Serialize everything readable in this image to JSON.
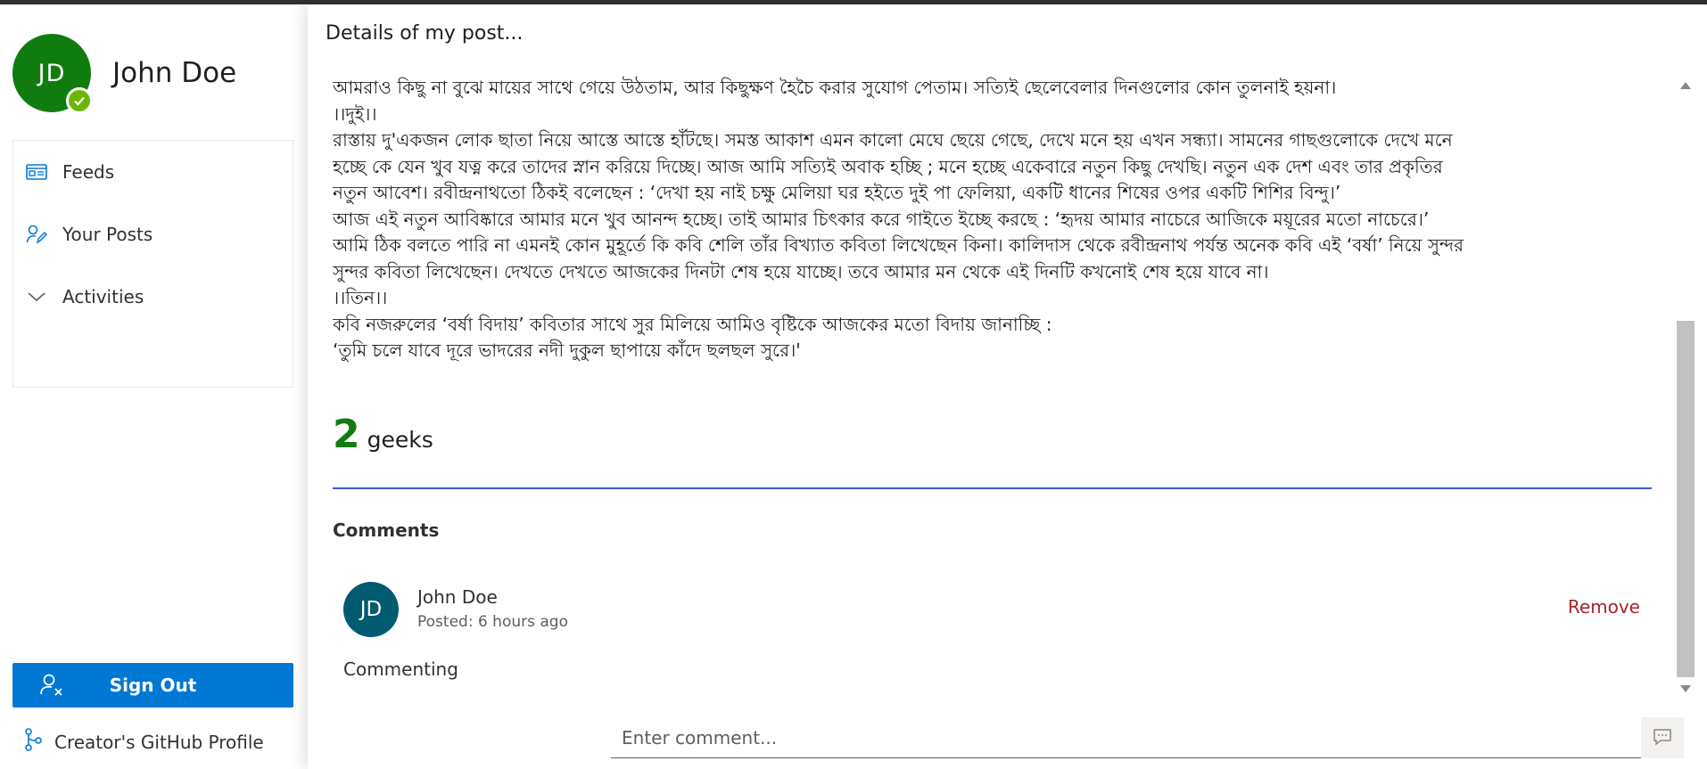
{
  "user": {
    "initials": "JD",
    "name": "John Doe"
  },
  "nav": [
    {
      "label": "Feeds",
      "icon": "feeds-icon"
    },
    {
      "label": "Your Posts",
      "icon": "posts-icon"
    },
    {
      "label": "Activities",
      "icon": "chevron-down-icon"
    }
  ],
  "sign_out_label": "Sign Out",
  "github_label": "Creator's GitHub Profile",
  "panel_title": "Details of my post...",
  "post_lines": [
    "আমরাও কিছু না বুঝে মায়ের সাথে গেয়ে উঠতাম, আর কিছুক্ষণ হৈচৈ করার সুযোগ পেতাম। সত্যিই ছেলেবেলার দিনগুলোর কোন তুলনাই হয়না।",
    "।।দুই।।",
    "রাস্তায় দু'একজন লোক ছাতা নিয়ে আস্তে আস্তে হাঁটছে। সমস্ত আকাশ এমন কালো মেঘে ছেয়ে গেছে, দেখে মনে হয় এখন সন্ধ্যা। সামনের গাছগুলোকে দেখে মনে",
    "হচ্ছে কে যেন খুব যত্ন করে তাদের স্নান করিয়ে দিচ্ছে। আজ আমি সত্যিই অবাক হচ্ছি ; মনে হচ্ছে একেবারে নতুন কিছু দেখছি। নতুন এক দেশ এবং তার প্রকৃতির",
    "নতুন আবেশ। রবীন্দ্রনাথতো ঠিকই বলেছেন : ‘দেখা হয় নাই চক্ষু মেলিয়া ঘর হইতে দুই পা ফেলিয়া, একটি ধানের শিষের ওপর একটি শিশির বিন্দু।’",
    "আজ এই নতুন আবিষ্কারে আমার মনে খুব আনন্দ হচ্ছে। তাই আমার চিৎকার করে গাইতে ইচ্ছে করছে : ‘হৃদয় আমার নাচেরে আজিকে ময়ূরের মতো নাচেরে।’",
    "আমি ঠিক বলতে পারি না এমনই কোন মুহূর্তে কি কবি শেলি তাঁর বিখ্যাত কবিতা লিখেছেন কিনা। কালিদাস থেকে রবীন্দ্রনাথ পর্যন্ত অনেক কবি এই ‘বর্ষা’ নিয়ে সুন্দর",
    "সুন্দর কবিতা লিখেছেন। দেখতে দেখতে আজকের দিনটা শেষ হয়ে যাচ্ছে। তবে আমার মন থেকে এই দিনটি কখনোই শেষ হয়ে যাবে না।",
    "।।তিন।।",
    "কবি নজরুলের ‘বর্ষা বিদায়’ কবিতার সাথে সুর মিলিয়ে আমিও বৃষ্টিকে আজকের মতো বিদায় জানাচ্ছি :",
    "‘তুমি চলে যাবে দূরে ভাদরের নদী দুকুল ছাপায়ে কাঁদে ছলছল সুরে।'"
  ],
  "geeks": {
    "count": "2",
    "label": "geeks"
  },
  "comments_heading": "Comments",
  "comment": {
    "initials": "JD",
    "author": "John Doe",
    "posted": "Posted: 6 hours ago",
    "remove_label": "Remove",
    "text": "Commenting"
  },
  "comment_input": {
    "placeholder": "Enter comment..."
  },
  "colors": {
    "avatar_green": "#107c10",
    "primary_blue": "#0078d4",
    "remove_red": "#a4262c",
    "comment_avatar": "#005b70",
    "divider_blue": "#3b5cc4"
  }
}
